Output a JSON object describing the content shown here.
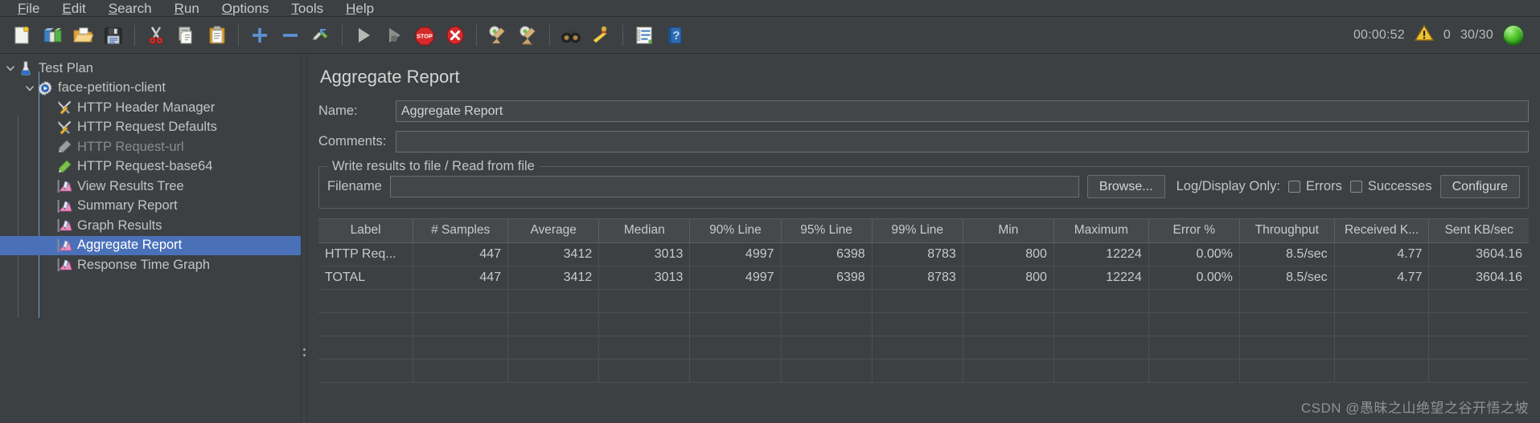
{
  "menu": {
    "items": [
      {
        "label": "File",
        "mnemonic": "F"
      },
      {
        "label": "Edit",
        "mnemonic": "E"
      },
      {
        "label": "Search",
        "mnemonic": "S"
      },
      {
        "label": "Run",
        "mnemonic": "R"
      },
      {
        "label": "Options",
        "mnemonic": "O"
      },
      {
        "label": "Tools",
        "mnemonic": "T"
      },
      {
        "label": "Help",
        "mnemonic": "H"
      }
    ]
  },
  "toolbar": {
    "buttons": [
      {
        "icon": "new-document-icon",
        "title": "New"
      },
      {
        "icon": "templates-icon",
        "title": "Templates"
      },
      {
        "icon": "open-folder-icon",
        "title": "Open"
      },
      {
        "icon": "save-floppy-icon",
        "title": "Save Test Plan"
      },
      {
        "icon": "cut-scissors-icon",
        "title": "Cut"
      },
      {
        "icon": "copy-pages-icon",
        "title": "Copy"
      },
      {
        "icon": "paste-clipboard-icon",
        "title": "Paste"
      },
      {
        "icon": "plus-icon",
        "title": "Expand All"
      },
      {
        "icon": "minus-icon",
        "title": "Collapse All"
      },
      {
        "icon": "toggle-pencil-icon",
        "title": "Toggle"
      },
      {
        "icon": "play-start-icon",
        "title": "Start"
      },
      {
        "icon": "play-no-pause-icon",
        "title": "Start no pauses"
      },
      {
        "icon": "stop-sign-icon",
        "title": "Stop"
      },
      {
        "icon": "shutdown-x-icon",
        "title": "Shutdown"
      },
      {
        "icon": "clear-gear-broom-icon",
        "title": "Clear"
      },
      {
        "icon": "clear-all-broom-icon",
        "title": "Clear All"
      },
      {
        "icon": "binoculars-search-icon",
        "title": "Search"
      },
      {
        "icon": "reset-search-broom-icon",
        "title": "Reset Search"
      },
      {
        "icon": "function-helper-icon",
        "title": "Function Helper Dialog"
      },
      {
        "icon": "help-book-icon",
        "title": "Help"
      }
    ],
    "status": {
      "elapsed": "00:00:52",
      "warning_icon": "warning-triangle-icon",
      "warning_count": "0",
      "threads": "30/30",
      "run_indicator": "running-green-indicator"
    }
  },
  "tree": {
    "items": [
      {
        "label": "Test Plan",
        "icon": "test-plan-flask-icon",
        "depth": 0,
        "twisty": "expanded",
        "selected": false,
        "disabled": false
      },
      {
        "label": "face-petition-client",
        "icon": "thread-group-gear-icon",
        "depth": 1,
        "twisty": "expanded",
        "selected": false,
        "disabled": false
      },
      {
        "label": "HTTP Header Manager",
        "icon": "config-tools-icon",
        "depth": 2,
        "twisty": "none",
        "selected": false,
        "disabled": false
      },
      {
        "label": "HTTP Request Defaults",
        "icon": "config-tools-icon",
        "depth": 2,
        "twisty": "none",
        "selected": false,
        "disabled": false
      },
      {
        "label": "HTTP Request-url",
        "icon": "sampler-pen-gray-icon",
        "depth": 2,
        "twisty": "none",
        "selected": false,
        "disabled": true
      },
      {
        "label": "HTTP Request-base64",
        "icon": "sampler-pen-green-icon",
        "depth": 2,
        "twisty": "none",
        "selected": false,
        "disabled": false
      },
      {
        "label": "View Results Tree",
        "icon": "listener-chart-icon",
        "depth": 2,
        "twisty": "none",
        "selected": false,
        "disabled": false
      },
      {
        "label": "Summary Report",
        "icon": "listener-chart-icon",
        "depth": 2,
        "twisty": "none",
        "selected": false,
        "disabled": false
      },
      {
        "label": "Graph Results",
        "icon": "listener-chart-icon",
        "depth": 2,
        "twisty": "none",
        "selected": false,
        "disabled": false
      },
      {
        "label": "Aggregate Report",
        "icon": "listener-chart-icon",
        "depth": 2,
        "twisty": "none",
        "selected": true,
        "disabled": false
      },
      {
        "label": "Response Time Graph",
        "icon": "listener-chart-icon",
        "depth": 2,
        "twisty": "none",
        "selected": false,
        "disabled": false
      }
    ]
  },
  "panel": {
    "title": "Aggregate Report",
    "name_label": "Name:",
    "name_value": "Aggregate Report",
    "name_placeholder": "",
    "comments_label": "Comments:",
    "comments_value": "",
    "comments_placeholder": "",
    "group_title": "Write results to file / Read from file",
    "filename_label": "Filename",
    "filename_value": "",
    "filename_placeholder": "",
    "browse_label": "Browse...",
    "logdisplay_label": "Log/Display Only:",
    "errors_label": "Errors",
    "errors_checked": false,
    "successes_label": "Successes",
    "successes_checked": false,
    "configure_label": "Configure"
  },
  "table": {
    "columns": [
      "Label",
      "# Samples",
      "Average",
      "Median",
      "90% Line",
      "95% Line",
      "99% Line",
      "Min",
      "Maximum",
      "Error %",
      "Throughput",
      "Received K...",
      "Sent KB/sec"
    ],
    "rows": [
      [
        "HTTP Req...",
        "447",
        "3412",
        "3013",
        "4997",
        "6398",
        "8783",
        "800",
        "12224",
        "0.00%",
        "8.5/sec",
        "4.77",
        "3604.16"
      ],
      [
        "TOTAL",
        "447",
        "3412",
        "3013",
        "4997",
        "6398",
        "8783",
        "800",
        "12224",
        "0.00%",
        "8.5/sec",
        "4.77",
        "3604.16"
      ]
    ]
  },
  "watermark": "CSDN @愚昧之山绝望之谷开悟之坡",
  "colors": {
    "window_bg": "#3c4043",
    "selection_blue": "#4a71b8",
    "text": "#c2c4c1",
    "header_bg": "#45494c",
    "border": "#5a5e61",
    "running_green": "#4fc42b",
    "warning_yellow": "#f2c230"
  }
}
